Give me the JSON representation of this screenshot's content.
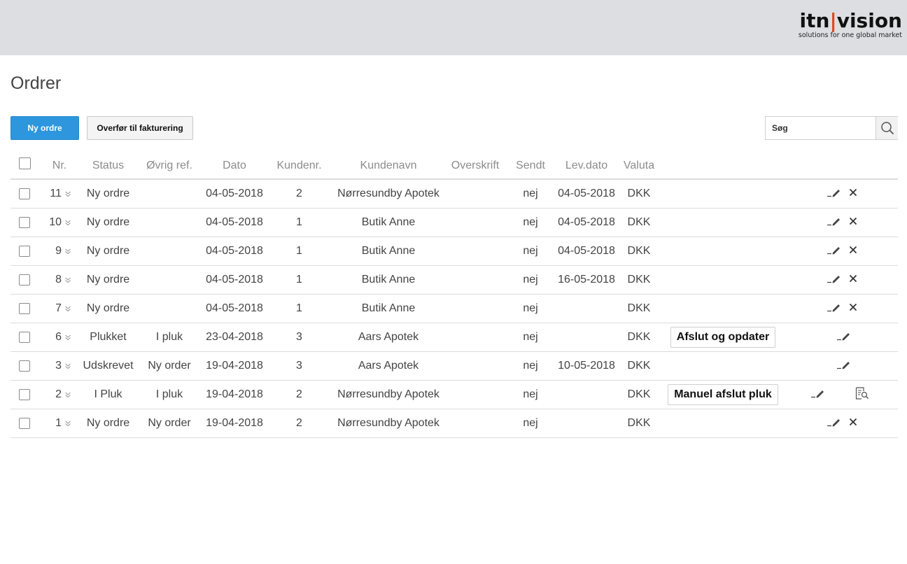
{
  "logo": {
    "left": "itn",
    "bar": "|",
    "right": "vision",
    "tagline": "solutions for one global market"
  },
  "page_title": "Ordrer",
  "toolbar": {
    "new_order_label": "Ny ordre",
    "transfer_label": "Overfør til fakturering"
  },
  "search": {
    "placeholder": "Søg",
    "value": ""
  },
  "table": {
    "headers": {
      "nr": "Nr.",
      "status": "Status",
      "ref": "Øvrig ref.",
      "date": "Dato",
      "custno": "Kundenr.",
      "custname": "Kundenavn",
      "heading": "Overskrift",
      "sent": "Sendt",
      "delivery": "Lev.dato",
      "currency": "Valuta"
    },
    "rows": [
      {
        "nr": "11",
        "status": "Ny ordre",
        "ref": "",
        "date": "04-05-2018",
        "custno": "2",
        "custname": "Nørresundby Apotek",
        "heading": "",
        "sent": "nej",
        "delivery": "04-05-2018",
        "currency": "DKK",
        "action": "",
        "icons": [
          "edit-icon",
          "delete-icon"
        ]
      },
      {
        "nr": "10",
        "status": "Ny ordre",
        "ref": "",
        "date": "04-05-2018",
        "custno": "1",
        "custname": "Butik Anne",
        "heading": "",
        "sent": "nej",
        "delivery": "04-05-2018",
        "currency": "DKK",
        "action": "",
        "icons": [
          "edit-icon",
          "delete-icon"
        ]
      },
      {
        "nr": "9",
        "status": "Ny ordre",
        "ref": "",
        "date": "04-05-2018",
        "custno": "1",
        "custname": "Butik Anne",
        "heading": "",
        "sent": "nej",
        "delivery": "04-05-2018",
        "currency": "DKK",
        "action": "",
        "icons": [
          "edit-icon",
          "delete-icon"
        ]
      },
      {
        "nr": "8",
        "status": "Ny ordre",
        "ref": "",
        "date": "04-05-2018",
        "custno": "1",
        "custname": "Butik Anne",
        "heading": "",
        "sent": "nej",
        "delivery": "16-05-2018",
        "currency": "DKK",
        "action": "",
        "icons": [
          "edit-icon",
          "delete-icon"
        ]
      },
      {
        "nr": "7",
        "status": "Ny ordre",
        "ref": "",
        "date": "04-05-2018",
        "custno": "1",
        "custname": "Butik Anne",
        "heading": "",
        "sent": "nej",
        "delivery": "",
        "currency": "DKK",
        "action": "",
        "icons": [
          "edit-icon",
          "delete-icon"
        ]
      },
      {
        "nr": "6",
        "status": "Plukket",
        "ref": "I pluk",
        "date": "23-04-2018",
        "custno": "3",
        "custname": "Aars Apotek",
        "heading": "",
        "sent": "nej",
        "delivery": "",
        "currency": "DKK",
        "action": "Afslut og opdater",
        "icons": [
          "edit-icon"
        ]
      },
      {
        "nr": "3",
        "status": "Udskrevet",
        "ref": "Ny order",
        "date": "19-04-2018",
        "custno": "3",
        "custname": "Aars Apotek",
        "heading": "",
        "sent": "nej",
        "delivery": "10-05-2018",
        "currency": "DKK",
        "action": "",
        "icons": [
          "edit-icon"
        ]
      },
      {
        "nr": "2",
        "status": "I Pluk",
        "ref": "I pluk",
        "date": "19-04-2018",
        "custno": "2",
        "custname": "Nørresundby Apotek",
        "heading": "",
        "sent": "nej",
        "delivery": "",
        "currency": "DKK",
        "action": "Manuel afslut pluk",
        "icons": [
          "edit-icon",
          "view-document-icon"
        ]
      },
      {
        "nr": "1",
        "status": "Ny ordre",
        "ref": "Ny order",
        "date": "19-04-2018",
        "custno": "2",
        "custname": "Nørresundby Apotek",
        "heading": "",
        "sent": "nej",
        "delivery": "",
        "currency": "DKK",
        "action": "",
        "icons": [
          "edit-icon",
          "delete-icon"
        ]
      }
    ]
  },
  "colors": {
    "primary_button": "#2d96dc",
    "header_bar": "#dcdee2",
    "logo_accent": "#e2471e"
  }
}
